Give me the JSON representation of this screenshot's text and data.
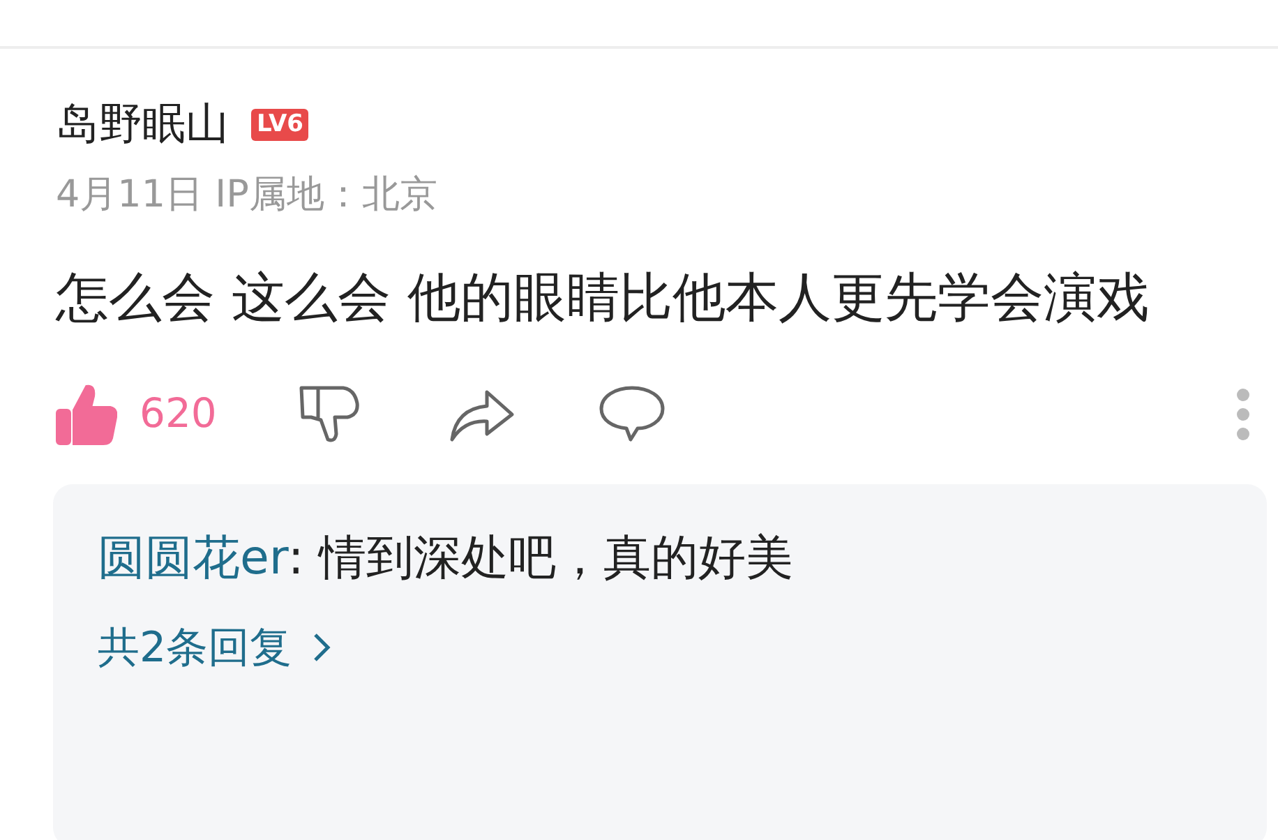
{
  "comment": {
    "author": "岛野眠山",
    "level_badge": "LV6",
    "meta": "4月11日 IP属地：北京",
    "text": "怎么会 这么会 他的眼睛比他本人更先学会演戏"
  },
  "actions": {
    "liked": true,
    "like_count": "620"
  },
  "replies": {
    "preview": [
      {
        "author": "圆圆花er",
        "text": ": 情到深处吧，真的好美"
      }
    ],
    "more": "共2条回复"
  }
}
